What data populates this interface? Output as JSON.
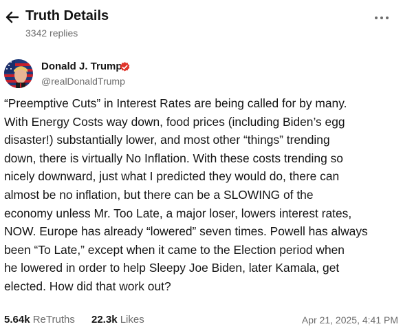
{
  "header": {
    "title": "Truth Details",
    "replies": "3342 replies",
    "back_icon": "arrow-left-icon",
    "more_icon": "more-horizontal-icon"
  },
  "author": {
    "display_name": "Donald J. Trump",
    "handle": "@realDonaldTrump",
    "verified_icon": "verified-badge-icon",
    "verified_color": "#e0352b"
  },
  "post": {
    "text": "“Preemptive Cuts” in Interest Rates are being called for by many.\nWith Energy Costs way down, food prices (including Biden’s egg\ndisaster!) substantially lower, and most other “things” trending\ndown, there is virtually No Inflation. With these costs trending so\nnicely downward, just what I predicted they would do, there can\nalmost be no inflation, but there can be a SLOWING of the\neconomy unless Mr. Too Late, a major loser, lowers interest rates,\nNOW. Europe has already “lowered” seven times. Powell has always\nbeen “To Late,” except when it came to the Election period when\nhe lowered in order to help Sleepy Joe Biden, later Kamala, get\nelected. How did that work out?"
  },
  "stats": {
    "retruths_count": "5.64k",
    "retruths_label": "ReTruths",
    "likes_count": "22.3k",
    "likes_label": "Likes",
    "timestamp": "Apr 21, 2025, 4:41 PM"
  }
}
